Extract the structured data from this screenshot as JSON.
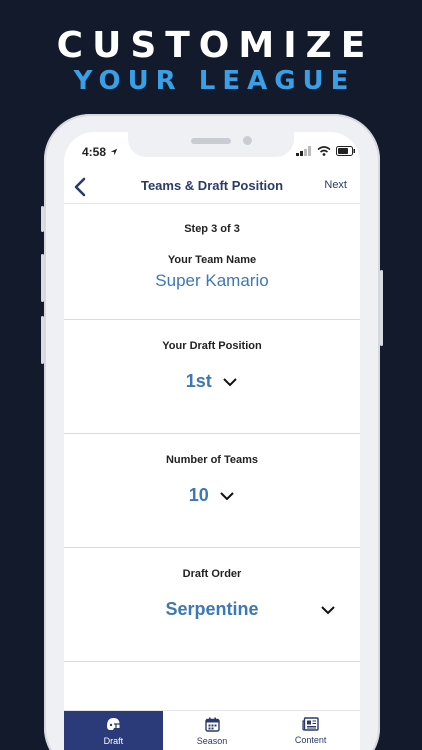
{
  "promo": {
    "headline": "CUSTOMIZE",
    "subheadline": "YOUR LEAGUE"
  },
  "status": {
    "time": "4:58"
  },
  "nav": {
    "title": "Teams & Draft Position",
    "next": "Next"
  },
  "step": "Step 3 of 3",
  "team_name": {
    "label": "Your Team Name",
    "value": "Super Kamario"
  },
  "draft_position": {
    "label": "Your Draft Position",
    "value": "1st"
  },
  "num_teams": {
    "label": "Number of Teams",
    "value": "10"
  },
  "draft_order": {
    "label": "Draft Order",
    "value": "Serpentine"
  },
  "tabs": [
    {
      "label": "Draft",
      "icon": "helmet-icon",
      "active": true
    },
    {
      "label": "Season",
      "icon": "calendar-icon",
      "active": false
    },
    {
      "label": "Content",
      "icon": "newspaper-icon",
      "active": false
    }
  ],
  "colors": {
    "background": "#131a2b",
    "accent": "#3d77b5",
    "nav": "#2b3a68",
    "headline_sub": "#3aa0e6"
  }
}
